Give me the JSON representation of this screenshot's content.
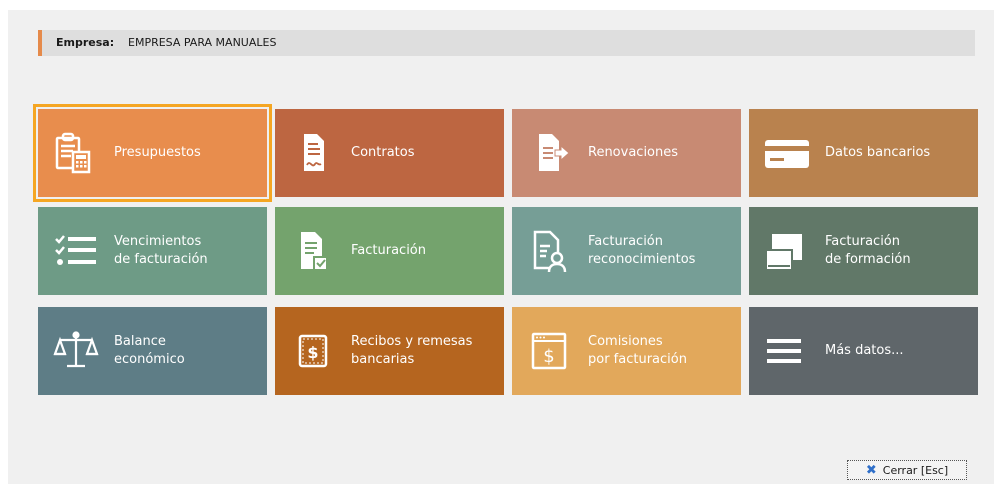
{
  "empresa": {
    "label": "Empresa:",
    "value": "EMPRESA PARA MANUALES"
  },
  "tiles": [
    {
      "label": "Presupuestos",
      "icon": "calculator-document-icon",
      "color": "#e88d4d"
    },
    {
      "label": "Contratos",
      "icon": "signed-contract-icon",
      "color": "#bd6641"
    },
    {
      "label": "Renovaciones",
      "icon": "document-arrow-icon",
      "color": "#c88a73"
    },
    {
      "label": "Datos bancarios",
      "icon": "credit-card-icon",
      "color": "#b9824e"
    },
    {
      "label": "Vencimientos\nde facturación",
      "icon": "checklist-icon",
      "color": "#6e9b86"
    },
    {
      "label": "Facturación",
      "icon": "invoice-check-icon",
      "color": "#74a36d"
    },
    {
      "label": "Facturación\nreconocimientos",
      "icon": "document-user-icon",
      "color": "#769e96"
    },
    {
      "label": "Facturación\nde formación",
      "icon": "books-icon",
      "color": "#617868"
    },
    {
      "label": "Balance\neconómico",
      "icon": "balance-scale-icon",
      "color": "#5e7d86"
    },
    {
      "label": "Recibos y remesas\nbancarias",
      "icon": "dollar-receipt-icon",
      "color": "#b5651f"
    },
    {
      "label": "Comisiones\npor facturación",
      "icon": "dollar-window-icon",
      "color": "#e2a85b"
    },
    {
      "label": "Más datos...",
      "icon": "hamburger-menu-icon",
      "color": "#5f666a"
    }
  ],
  "close_button": {
    "label": "Cerrar [Esc]",
    "icon": "close-icon"
  }
}
